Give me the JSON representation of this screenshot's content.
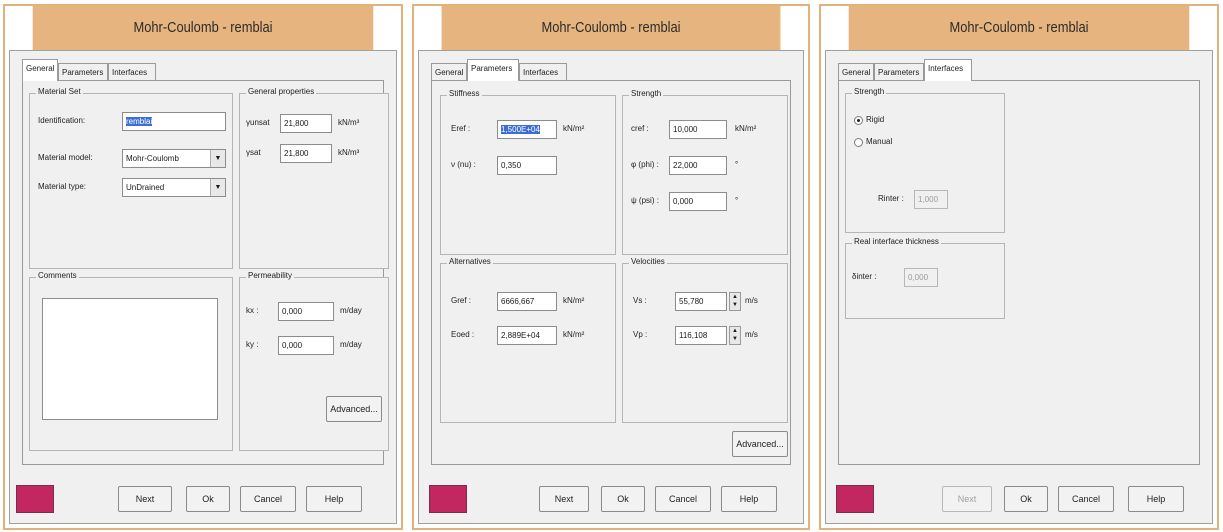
{
  "windows": [
    {
      "title": "Mohr-Coulomb - remblai",
      "tabs": [
        "General",
        "Parameters",
        "Interfaces"
      ],
      "active_tab": "General",
      "material_set": {
        "group_label": "Material Set",
        "identification_label": "Identification:",
        "identification_value": "remblai",
        "material_model_label": "Material model:",
        "material_model_value": "Mohr-Coulomb",
        "material_type_label": "Material type:",
        "material_type_value": "UnDrained"
      },
      "general_properties": {
        "group_label": "General properties",
        "gamma_unsat_label": "γunsat",
        "gamma_unsat_value": "21,800",
        "gamma_sat_label": "γsat",
        "gamma_sat_value": "21,800",
        "unit": "kN/m³"
      },
      "comments": {
        "group_label": "Comments",
        "value": ""
      },
      "permeability": {
        "group_label": "Permeability",
        "kx_label": "kx :",
        "kx_value": "0,000",
        "ky_label": "ky :",
        "ky_value": "0,000",
        "unit": "m/day",
        "advanced_label": "Advanced..."
      },
      "buttons": {
        "next": "Next",
        "ok": "Ok",
        "cancel": "Cancel",
        "help": "Help"
      },
      "swatch_color": "#c2275f"
    },
    {
      "title": "Mohr-Coulomb - remblai",
      "tabs": [
        "General",
        "Parameters",
        "Interfaces"
      ],
      "active_tab": "Parameters",
      "stiffness": {
        "group_label": "Stiffness",
        "eref_label": "Eref :",
        "eref_value": "1,500E+04",
        "eref_unit": "kN/m²",
        "nu_label": "ν (nu) :",
        "nu_value": "0,350"
      },
      "strength": {
        "group_label": "Strength",
        "cref_label": "cref :",
        "cref_value": "10,000",
        "cref_unit": "kN/m²",
        "phi_label": "φ (phi) :",
        "phi_value": "22,000",
        "phi_unit": "°",
        "psi_label": "ψ (psi) :",
        "psi_value": "0,000",
        "psi_unit": "°"
      },
      "alternatives": {
        "group_label": "Alternatives",
        "gref_label": "Gref :",
        "gref_value": "6666,667",
        "gref_unit": "kN/m²",
        "eoed_label": "Eoed :",
        "eoed_value": "2,889E+04",
        "eoed_unit": "kN/m²"
      },
      "velocities": {
        "group_label": "Velocities",
        "vs_label": "Vs :",
        "vs_value": "55,780",
        "vp_label": "Vp :",
        "vp_value": "116,108",
        "unit": "m/s"
      },
      "advanced_label": "Advanced...",
      "buttons": {
        "next": "Next",
        "ok": "Ok",
        "cancel": "Cancel",
        "help": "Help"
      },
      "swatch_color": "#c2275f"
    },
    {
      "title": "Mohr-Coulomb - remblai",
      "tabs": [
        "General",
        "Parameters",
        "Interfaces"
      ],
      "active_tab": "Interfaces",
      "strength": {
        "group_label": "Strength",
        "rigid_label": "Rigid",
        "manual_label": "Manual",
        "rinter_label": "Rinter :",
        "rinter_value": "1,000"
      },
      "thickness": {
        "group_label": "Real interface thickness",
        "dinter_label": "δinter :",
        "dinter_value": "0,000"
      },
      "buttons": {
        "next": "Next",
        "ok": "Ok",
        "cancel": "Cancel",
        "help": "Help"
      },
      "swatch_color": "#c2275f"
    }
  ]
}
